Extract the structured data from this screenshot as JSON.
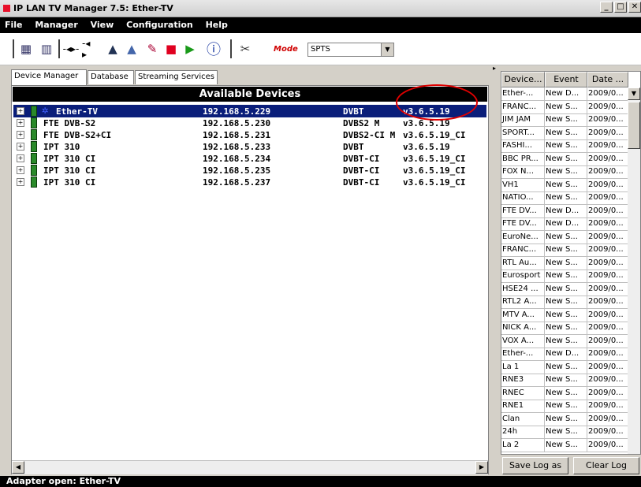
{
  "window": {
    "title": "IP LAN TV Manager 7.5: Ether-TV",
    "controls": [
      "_",
      "□",
      "✕"
    ]
  },
  "menu": [
    "File",
    "Manager",
    "View",
    "Configuration",
    "Help"
  ],
  "toolbar": {
    "mode_label": "Mode",
    "mode_value": "SPTS",
    "icons": [
      "device-icon",
      "device-add-icon",
      "connect-icon",
      "disconnect-icon",
      "up-icon",
      "up-alt-icon",
      "tools-icon",
      "stop-icon",
      "play-icon",
      "info-icon",
      "settings-icon"
    ]
  },
  "tabs": [
    "Device Manager",
    "Database",
    "Streaming Services"
  ],
  "available_devices": {
    "header": "Available Devices",
    "rows": [
      {
        "name": "Ether-TV",
        "ip": "192.168.5.229",
        "type": "DVBT",
        "version": "v3.6.5.19",
        "selected": true
      },
      {
        "name": "FTE DVB-S2",
        "ip": "192.168.5.230",
        "type": "DVBS2 M",
        "version": "v3.6.5.19"
      },
      {
        "name": "FTE DVB-S2+CI",
        "ip": "192.168.5.231",
        "type": "DVBS2-CI M",
        "version": "v3.6.5.19_CI"
      },
      {
        "name": "IPT 310",
        "ip": "192.168.5.233",
        "type": "DVBT",
        "version": "v3.6.5.19"
      },
      {
        "name": "IPT 310 CI",
        "ip": "192.168.5.234",
        "type": "DVBT-CI",
        "version": "v3.6.5.19_CI"
      },
      {
        "name": "IPT 310 CI",
        "ip": "192.168.5.235",
        "type": "DVBT-CI",
        "version": "v3.6.5.19_CI"
      },
      {
        "name": "IPT 310 CI",
        "ip": "192.168.5.237",
        "type": "DVBT-CI",
        "version": "v3.6.5.19_CI"
      }
    ]
  },
  "log": {
    "headers": [
      "Device...",
      "Event",
      "Date ..."
    ],
    "rows": [
      [
        "Ether-...",
        "New D...",
        "2009/0..."
      ],
      [
        "FRANC...",
        "New S...",
        "2009/0..."
      ],
      [
        "JIM JAM",
        "New S...",
        "2009/0..."
      ],
      [
        "SPORT...",
        "New S...",
        "2009/0..."
      ],
      [
        "FASHI...",
        "New S...",
        "2009/0..."
      ],
      [
        "BBC PR...",
        "New S...",
        "2009/0..."
      ],
      [
        "FOX N...",
        "New S...",
        "2009/0..."
      ],
      [
        "VH1",
        "New S...",
        "2009/0..."
      ],
      [
        "NATIO...",
        "New S...",
        "2009/0..."
      ],
      [
        "FTE DV...",
        "New D...",
        "2009/0..."
      ],
      [
        "FTE DV...",
        "New D...",
        "2009/0..."
      ],
      [
        "EuroNe...",
        "New S...",
        "2009/0..."
      ],
      [
        "FRANC...",
        "New S...",
        "2009/0..."
      ],
      [
        "RTL Au...",
        "New S...",
        "2009/0..."
      ],
      [
        "Eurosport",
        "New S...",
        "2009/0..."
      ],
      [
        "HSE24 ...",
        "New S...",
        "2009/0..."
      ],
      [
        "RTL2 A...",
        "New S...",
        "2009/0..."
      ],
      [
        "MTV A...",
        "New S...",
        "2009/0..."
      ],
      [
        "NICK A...",
        "New S...",
        "2009/0..."
      ],
      [
        "VOX A...",
        "New S...",
        "2009/0..."
      ],
      [
        "Ether-...",
        "New D...",
        "2009/0..."
      ],
      [
        "La 1",
        "New S...",
        "2009/0..."
      ],
      [
        "RNE3",
        "New S...",
        "2009/0..."
      ],
      [
        "RNEC",
        "New S...",
        "2009/0..."
      ],
      [
        "RNE1",
        "New S...",
        "2009/0..."
      ],
      [
        "Clan",
        "New S...",
        "2009/0..."
      ],
      [
        "24h",
        "New S...",
        "2009/0..."
      ],
      [
        "La 2",
        "New S...",
        "2009/0..."
      ]
    ],
    "save_label": "Save Log as",
    "clear_label": "Clear Log"
  },
  "status": "Adapter open: Ether-TV"
}
